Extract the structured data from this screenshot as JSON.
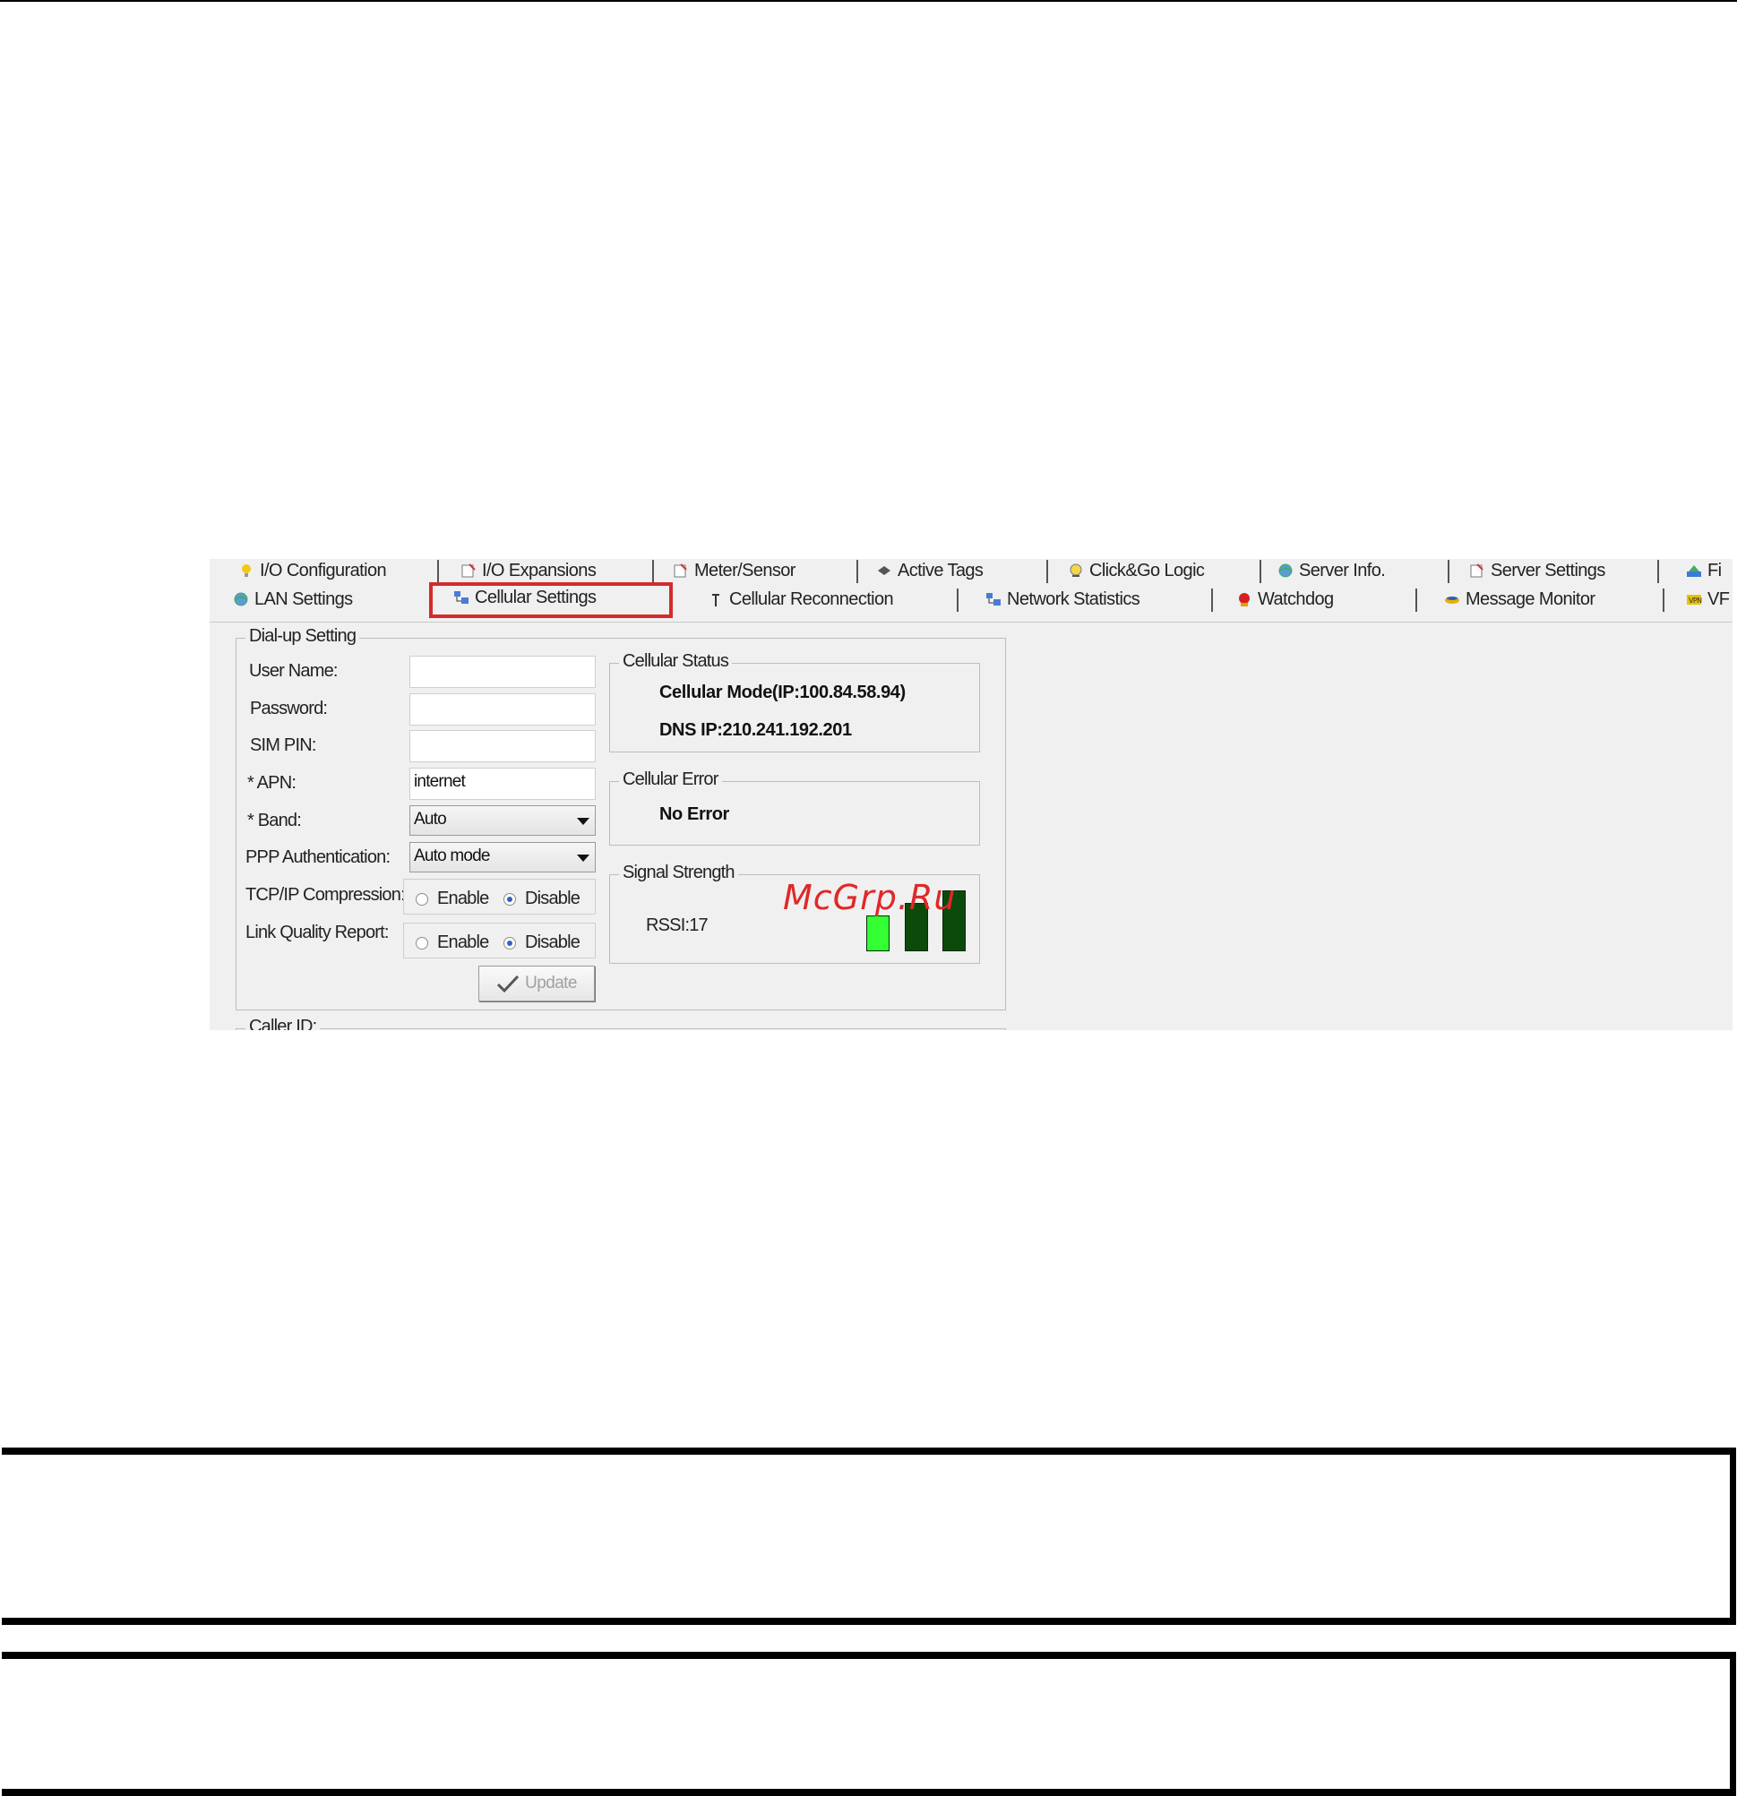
{
  "tabs_row1": [
    {
      "label": "I/O Configuration",
      "icon": "lightbulb-icon"
    },
    {
      "label": "I/O Expansions",
      "icon": "io-expansion-icon"
    },
    {
      "label": "Meter/Sensor",
      "icon": "meter-icon"
    },
    {
      "label": "Active Tags",
      "icon": "active-tags-icon"
    },
    {
      "label": "Click&Go Logic",
      "icon": "logic-icon"
    },
    {
      "label": "Server Info.",
      "icon": "globe-icon"
    },
    {
      "label": "Server Settings",
      "icon": "server-settings-icon"
    },
    {
      "label": "Fi",
      "icon": "firmware-icon"
    }
  ],
  "tabs_row2": [
    {
      "label": "LAN Settings",
      "icon": "globe-icon"
    },
    {
      "label": "Cellular Settings",
      "icon": "network-icon",
      "selected": true
    },
    {
      "label": "Cellular Reconnection",
      "icon": "antenna-icon"
    },
    {
      "label": "Network Statistics",
      "icon": "network-icon"
    },
    {
      "label": "Watchdog",
      "icon": "watchdog-icon"
    },
    {
      "label": "Message Monitor",
      "icon": "message-icon"
    },
    {
      "label": "VF",
      "icon": "vpn-icon"
    }
  ],
  "dialup": {
    "title": "Dial-up Setting",
    "user_name_label": "User Name:",
    "user_name_value": "",
    "password_label": "Password:",
    "password_value": "",
    "sim_pin_label": "SIM PIN:",
    "sim_pin_value": "",
    "apn_label": "* APN:",
    "apn_value": "internet",
    "band_label": "* Band:",
    "band_value": "Auto",
    "ppp_label": "PPP Authentication:",
    "ppp_value": "Auto mode",
    "tcpip_label": "TCP/IP Compression:",
    "lqr_label": "Link Quality Report:",
    "enable_label": "Enable",
    "disable_label": "Disable",
    "tcpip_selected": "Disable",
    "lqr_selected": "Disable",
    "update_label": "Update"
  },
  "cellular_status": {
    "title": "Cellular Status",
    "mode_text": "Cellular Mode(IP:100.84.58.94)",
    "dns_text": "DNS IP:210.241.192.201"
  },
  "cellular_error": {
    "title": "Cellular Error",
    "text": "No Error"
  },
  "signal": {
    "title": "Signal Strength",
    "rssi_text": "RSSI:17",
    "bars_active": 1,
    "bars_total": 3,
    "color_active": "#33ff33",
    "color_inactive": "#0b4a0b"
  },
  "caller_id_title": "Caller ID:",
  "watermark": "McGrp.Ru",
  "highlight_color": "#d42b2b"
}
